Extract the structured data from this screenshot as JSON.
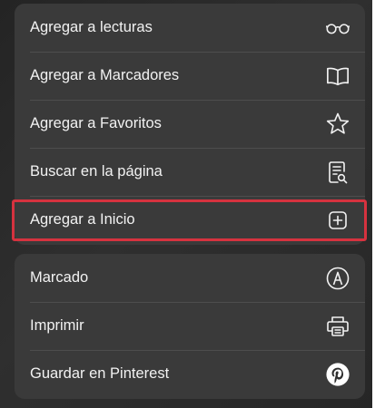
{
  "menu": {
    "group1": [
      {
        "label": "Agregar a lecturas",
        "icon": "glasses-icon"
      },
      {
        "label": "Agregar a Marcadores",
        "icon": "book-icon"
      },
      {
        "label": "Agregar a Favoritos",
        "icon": "star-icon"
      },
      {
        "label": "Buscar en la página",
        "icon": "find-on-page-icon"
      },
      {
        "label": "Agregar a Inicio",
        "icon": "add-square-icon"
      }
    ],
    "group2": [
      {
        "label": "Marcado",
        "icon": "markup-pen-icon"
      },
      {
        "label": "Imprimir",
        "icon": "printer-icon"
      },
      {
        "label": "Guardar en Pinterest",
        "icon": "pinterest-icon"
      }
    ]
  },
  "colors": {
    "background": "#2a2a2a",
    "panel": "#3a3a3a",
    "text": "#f2f2f2",
    "highlight": "#d6323f"
  }
}
